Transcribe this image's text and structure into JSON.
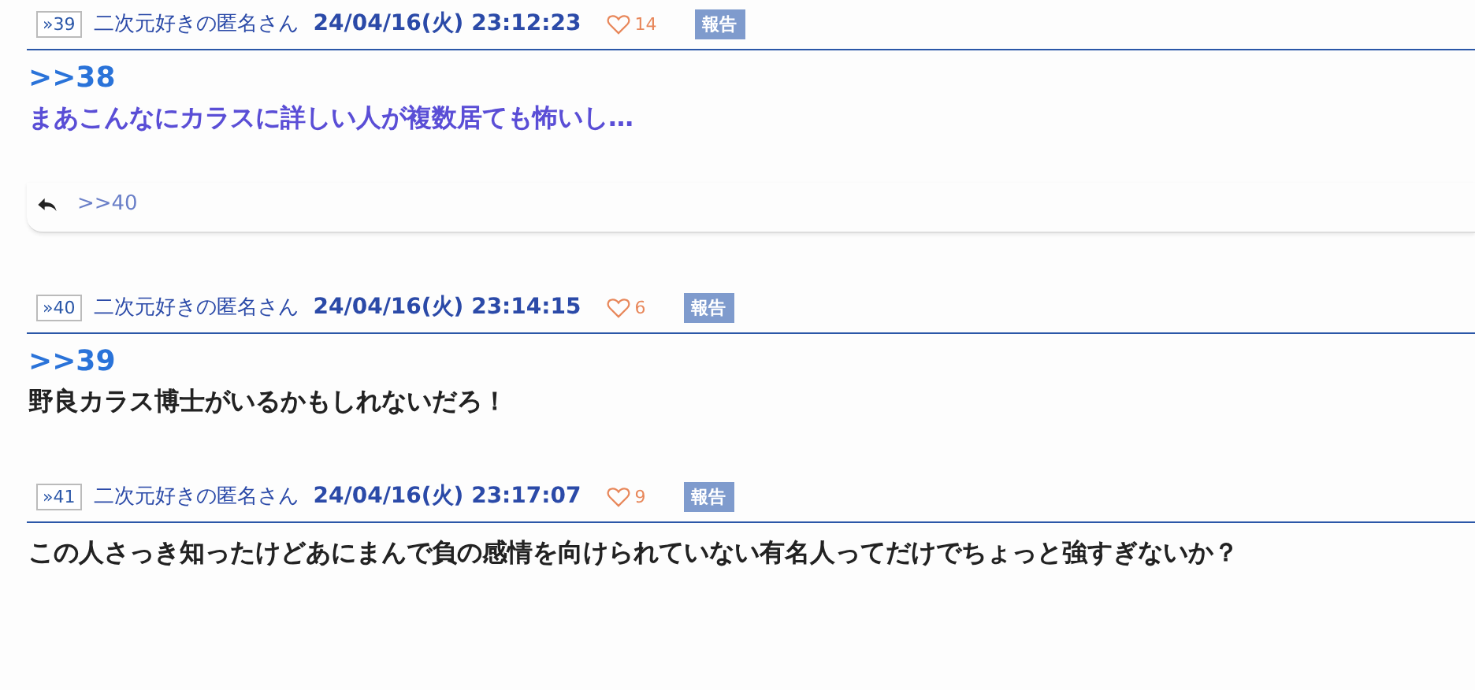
{
  "posts": [
    {
      "number": "»39",
      "name": "二次元好きの匿名さん",
      "date": "24/04/16(火) 23:12:23",
      "likes": "14",
      "report": "報告",
      "anchor": ">>38",
      "body": "まあこんなにカラスに詳しい人が複数居ても怖いし…",
      "highlighted": true,
      "replies": [
        ">>40"
      ]
    },
    {
      "number": "»40",
      "name": "二次元好きの匿名さん",
      "date": "24/04/16(火) 23:14:15",
      "likes": "6",
      "report": "報告",
      "anchor": ">>39",
      "body": "野良カラス博士がいるかもしれないだろ！",
      "highlighted": false
    },
    {
      "number": "»41",
      "name": "二次元好きの匿名さん",
      "date": "24/04/16(火) 23:17:07",
      "likes": "9",
      "report": "報告",
      "body": "この人さっき知ったけどあにまんで負の感情を向けられていない有名人ってだけでちょっと強すぎないか？",
      "highlighted": false
    }
  ]
}
